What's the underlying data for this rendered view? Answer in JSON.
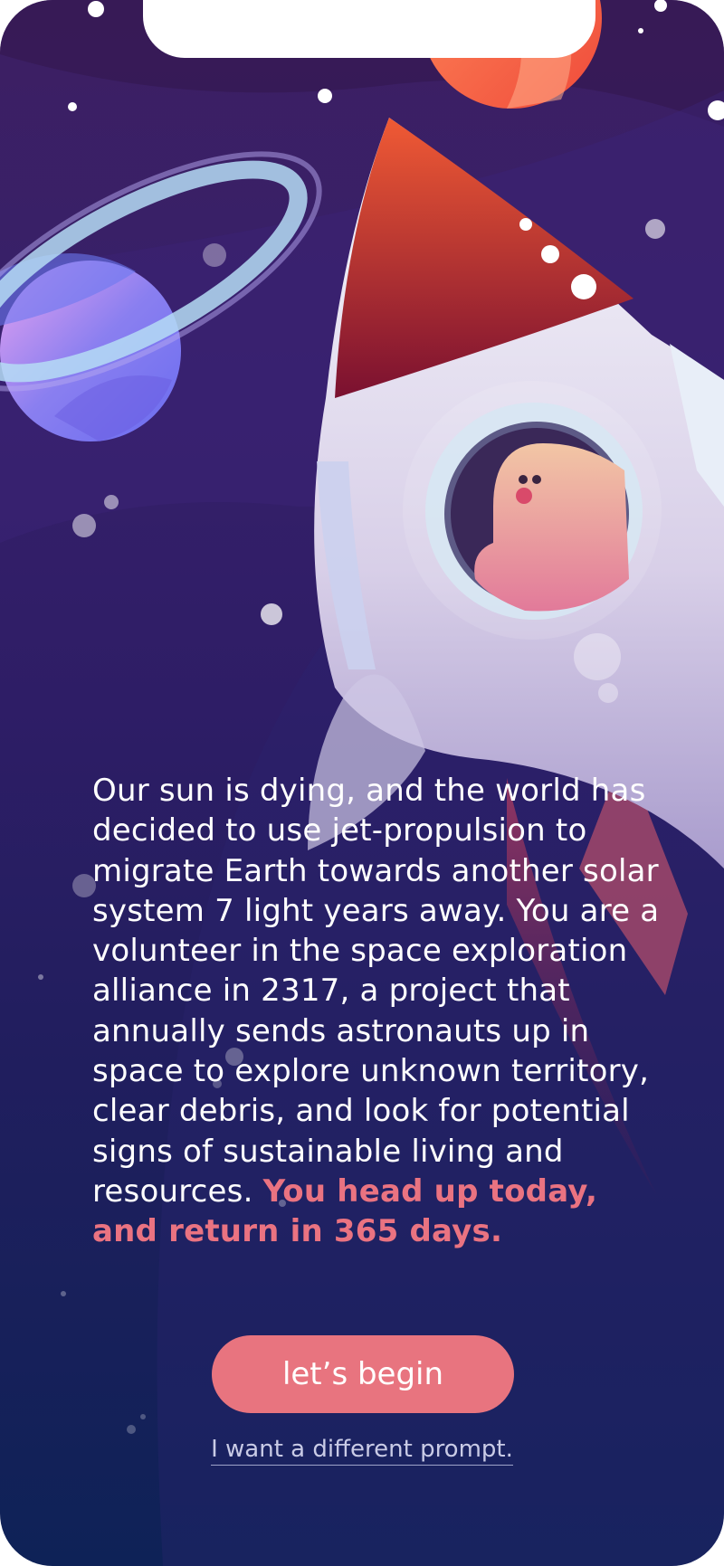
{
  "story": {
    "body": "Our sun is dying, and the world has decided to use jet-propulsion to migrate Earth towards another solar system 7 light years away. You are a volunteer in the space exploration alliance in 2317, a project that annually sends astronauts up in space to explore unknown territory, clear debris, and look for potential signs of sustainable living and resources.",
    "highlight": "You head up today, and return in 365 days."
  },
  "actions": {
    "begin_label": "let’s begin",
    "alt_label": "I want a different prompt."
  },
  "colors": {
    "accent": "#e8747f",
    "highlight_text": "#ea7381",
    "bg_top": "#3d1f63",
    "bg_bottom": "#0e2257"
  }
}
